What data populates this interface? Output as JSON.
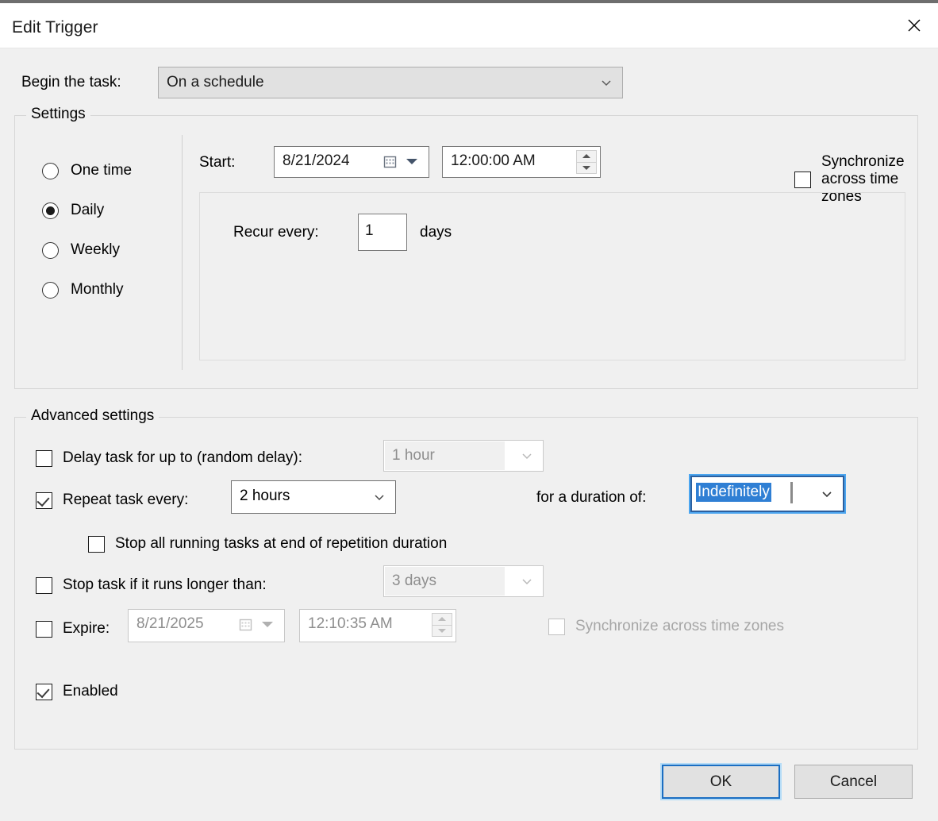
{
  "window": {
    "title": "Edit Trigger",
    "close_icon": "close-icon"
  },
  "begin": {
    "label": "Begin the task:",
    "value": "On a schedule",
    "chevron_icon": "chevron-down-icon"
  },
  "settings": {
    "group_label": "Settings",
    "schedule_options": [
      {
        "label": "One time",
        "selected": false
      },
      {
        "label": "Daily",
        "selected": true
      },
      {
        "label": "Weekly",
        "selected": false
      },
      {
        "label": "Monthly",
        "selected": false
      }
    ],
    "start_label": "Start:",
    "start_date": "8/21/2024",
    "start_time": "12:00:00 AM",
    "calendar_icon": "calendar-icon",
    "sync_label": "Synchronize across time zones",
    "sync_checked": false,
    "recur_label": "Recur every:",
    "recur_value": "1",
    "recur_unit": "days"
  },
  "advanced": {
    "group_label": "Advanced settings",
    "delay_label": "Delay task for up to (random delay):",
    "delay_value": "1 hour",
    "delay_checked": false,
    "repeat_label": "Repeat task every:",
    "repeat_value": "2 hours",
    "repeat_checked": true,
    "duration_label": "for a duration of:",
    "duration_value": "Indefinitely",
    "stop_all_label": "Stop all running tasks at end of repetition duration",
    "stop_all_checked": false,
    "stop_long_label": "Stop task if it runs longer than:",
    "stop_long_value": "3 days",
    "stop_long_checked": false,
    "expire_label": "Expire:",
    "expire_date": "8/21/2025",
    "expire_time": "12:10:35 AM",
    "expire_checked": false,
    "expire_sync_label": "Synchronize across time zones",
    "expire_sync_checked": false,
    "enabled_label": "Enabled",
    "enabled_checked": true
  },
  "footer": {
    "ok_label": "OK",
    "cancel_label": "Cancel"
  },
  "colors": {
    "dialog_background": "#f0f0f0",
    "titlebar_background": "#ffffff",
    "selection_blue": "#2f7fd4",
    "focus_blue": "#1b6ec2",
    "focus_halo": "#b5dcf7",
    "disabled_text": "#8e8e8e"
  }
}
